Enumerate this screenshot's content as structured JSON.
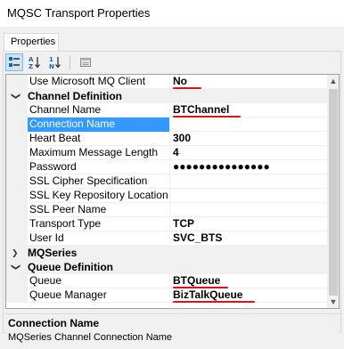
{
  "window": {
    "title": "MQSC Transport Properties"
  },
  "tabs": [
    {
      "label": "Properties"
    }
  ],
  "toolbar": {
    "buttons": [
      {
        "icon": "categorized-icon",
        "active": true
      },
      {
        "icon": "alphabetical-sort-icon",
        "active": false
      },
      {
        "icon": "numeric-sort-icon",
        "active": false
      },
      {
        "icon": "property-pages-icon",
        "active": false
      }
    ]
  },
  "grid": {
    "rows": [
      {
        "type": "prop",
        "name": "Use Microsoft MQ Client",
        "value": "No"
      },
      {
        "type": "category",
        "name": "Channel Definition",
        "expanded": true
      },
      {
        "type": "prop",
        "name": "Channel Name",
        "value": "BTChannel"
      },
      {
        "type": "prop",
        "name": "Connection Name",
        "value": "",
        "selected": true
      },
      {
        "type": "prop",
        "name": "Heart Beat",
        "value": "300"
      },
      {
        "type": "prop",
        "name": "Maximum Message Length",
        "value": "4"
      },
      {
        "type": "prop",
        "name": "Password",
        "value": "●●●●●●●●●●●●●●●"
      },
      {
        "type": "prop",
        "name": "SSL Cipher Specification",
        "value": ""
      },
      {
        "type": "prop",
        "name": "SSL Key Repository Location",
        "value": ""
      },
      {
        "type": "prop",
        "name": "SSL Peer Name",
        "value": ""
      },
      {
        "type": "prop",
        "name": "Transport Type",
        "value": "TCP"
      },
      {
        "type": "prop",
        "name": "User Id",
        "value": "SVC_BTS"
      },
      {
        "type": "category",
        "name": "MQSeries",
        "expanded": false
      },
      {
        "type": "category",
        "name": "Queue Definition",
        "expanded": true
      },
      {
        "type": "prop",
        "name": "Queue",
        "value": "BTQueue"
      },
      {
        "type": "prop",
        "name": "Queue Manager",
        "value": "BizTalkQueue"
      }
    ]
  },
  "description": {
    "title": "Connection Name",
    "text": "MQSeries Channel Connection Name"
  },
  "colors": {
    "selection": "#3399ff",
    "annotation_underline": "#e0101a"
  }
}
